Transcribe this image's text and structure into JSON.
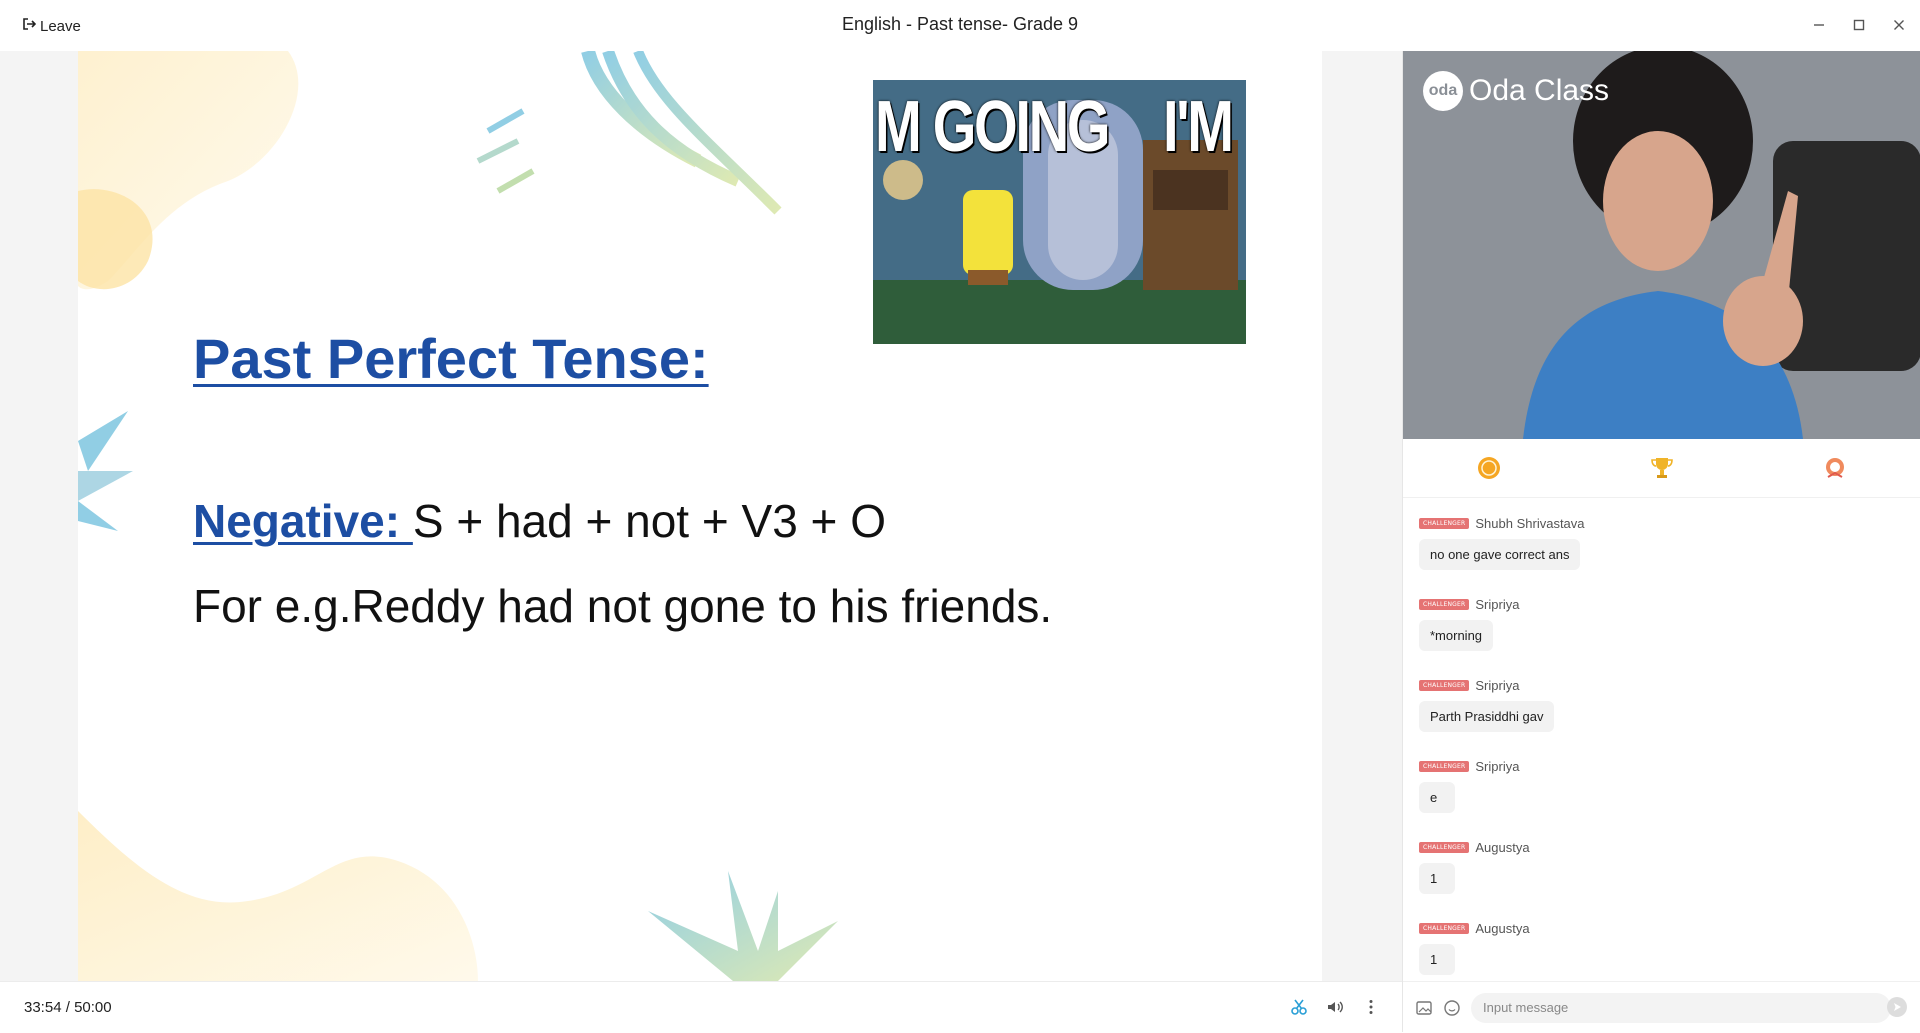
{
  "titlebar": {
    "leave_label": "Leave",
    "title": "English - Past tense- Grade 9"
  },
  "slide": {
    "heading": "Past Perfect Tense:",
    "negative_label": "Negative: ",
    "negative_formula": "S + had + not + V3 + O",
    "example": "For e.g.Reddy had not gone to his friends.",
    "gif_caption_left": "M GOING",
    "gif_caption_right": "I'M"
  },
  "player": {
    "current_time": "33:54",
    "separator": "/",
    "total_time": "50:00"
  },
  "video": {
    "logo_badge": "oda",
    "logo_text": "Oda Class"
  },
  "chat": {
    "badge_text": "CHALLENGER",
    "messages": [
      {
        "user": "Shubh Shrivastava",
        "text": "no one gave correct ans"
      },
      {
        "user": "Sripriya",
        "text": "*morning"
      },
      {
        "user": "Sripriya",
        "text": "Parth Prasiddhi gav"
      },
      {
        "user": "Sripriya",
        "text": "e"
      },
      {
        "user": "Augustya",
        "text": "1"
      },
      {
        "user": "Augustya",
        "text": "1"
      }
    ],
    "input_placeholder": "Input message"
  },
  "colors": {
    "heading_blue": "#1d4ea3",
    "badge_red": "#e57373",
    "coin_orange": "#f5a623",
    "trophy_gold": "#f0b429"
  }
}
